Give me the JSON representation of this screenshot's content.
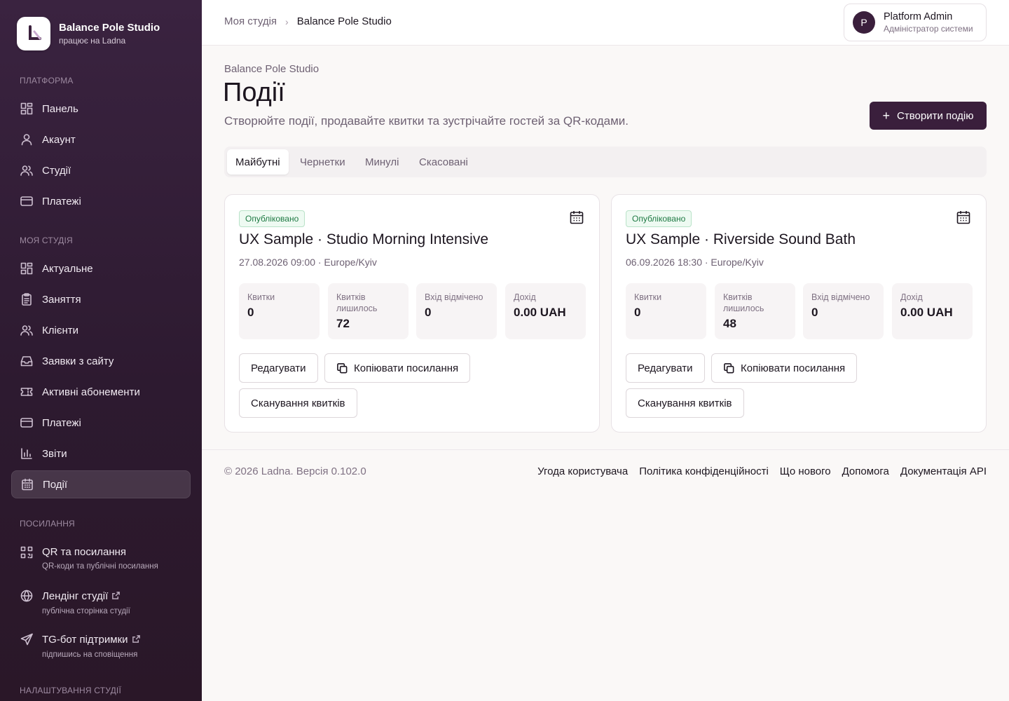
{
  "brand": {
    "title": "Balance Pole Studio",
    "subtitle": "працює на Ladna"
  },
  "sidebar": {
    "sections": {
      "platform": "ПЛАТФОРМА",
      "my_studio": "МОЯ СТУДІЯ",
      "links": "ПОСИЛАННЯ",
      "settings": "НАЛАШТУВАННЯ СТУДІЇ"
    },
    "platform_items": [
      {
        "label": "Панель",
        "icon": "dashboard-icon"
      },
      {
        "label": "Акаунт",
        "icon": "user-icon"
      },
      {
        "label": "Студії",
        "icon": "users-icon"
      },
      {
        "label": "Платежі",
        "icon": "credit-card-icon"
      }
    ],
    "studio_items": [
      {
        "label": "Актуальне",
        "icon": "dashboard-icon"
      },
      {
        "label": "Заняття",
        "icon": "clipboard-icon"
      },
      {
        "label": "Клієнти",
        "icon": "users-icon"
      },
      {
        "label": "Заявки з сайту",
        "icon": "inbox-icon"
      },
      {
        "label": "Активні абонементи",
        "icon": "ticket-icon"
      },
      {
        "label": "Платежі",
        "icon": "credit-card-icon"
      },
      {
        "label": "Звіти",
        "icon": "bar-chart-icon"
      },
      {
        "label": "Події",
        "icon": "calendar-icon"
      }
    ],
    "link_items": [
      {
        "label": "QR та посилання",
        "sub": "QR-коди та публічні посилання",
        "icon": "qr-icon"
      },
      {
        "label": "Лендінг студії",
        "sub": "публічна сторінка студії",
        "icon": "globe-icon"
      },
      {
        "label": "TG-бот підтримки",
        "sub": "підпишись на сповіщення",
        "icon": "send-icon"
      }
    ]
  },
  "header": {
    "breadcrumb": {
      "parent": "Моя студія",
      "current": "Balance Pole Studio"
    },
    "user": {
      "initial": "P",
      "name": "Platform Admin",
      "role": "Адміністратор системи"
    }
  },
  "page": {
    "eyebrow": "Balance Pole Studio",
    "title": "Події",
    "description": "Створюйте події, продавайте квитки та зустрічайте гостей за QR-кодами.",
    "create_button": "Створити подію"
  },
  "tabs": [
    "Майбутні",
    "Чернетки",
    "Минулі",
    "Скасовані"
  ],
  "events": [
    {
      "status": "Опубліковано",
      "title": "UX Sample · Studio Morning Intensive",
      "datetime": "27.08.2026 09:00 · Europe/Kyiv",
      "stats": [
        {
          "label": "Квитки",
          "value": "0"
        },
        {
          "label": "Квитків лишилось",
          "value": "72"
        },
        {
          "label": "Вхід відмічено",
          "value": "0"
        },
        {
          "label": "Дохід",
          "value": "0.00 UAH"
        }
      ],
      "buttons": {
        "edit": "Редагувати",
        "copy": "Копіювати посилання",
        "scan": "Сканування квитків"
      }
    },
    {
      "status": "Опубліковано",
      "title": "UX Sample · Riverside Sound Bath",
      "datetime": "06.09.2026 18:30 · Europe/Kyiv",
      "stats": [
        {
          "label": "Квитки",
          "value": "0"
        },
        {
          "label": "Квитків лишилось",
          "value": "48"
        },
        {
          "label": "Вхід відмічено",
          "value": "0"
        },
        {
          "label": "Дохід",
          "value": "0.00 UAH"
        }
      ],
      "buttons": {
        "edit": "Редагувати",
        "copy": "Копіювати посилання",
        "scan": "Сканування квитків"
      }
    }
  ],
  "footer": {
    "copyright": "© 2026 Ladna. Версія 0.102.0",
    "links": [
      "Угода користувача",
      "Політика конфіденційності",
      "Що нового",
      "Допомога",
      "Документація API"
    ]
  },
  "colors": {
    "sidebar_bg": "#3a2340",
    "accent": "#3a1f3c",
    "published_badge": "#1f7a44"
  }
}
